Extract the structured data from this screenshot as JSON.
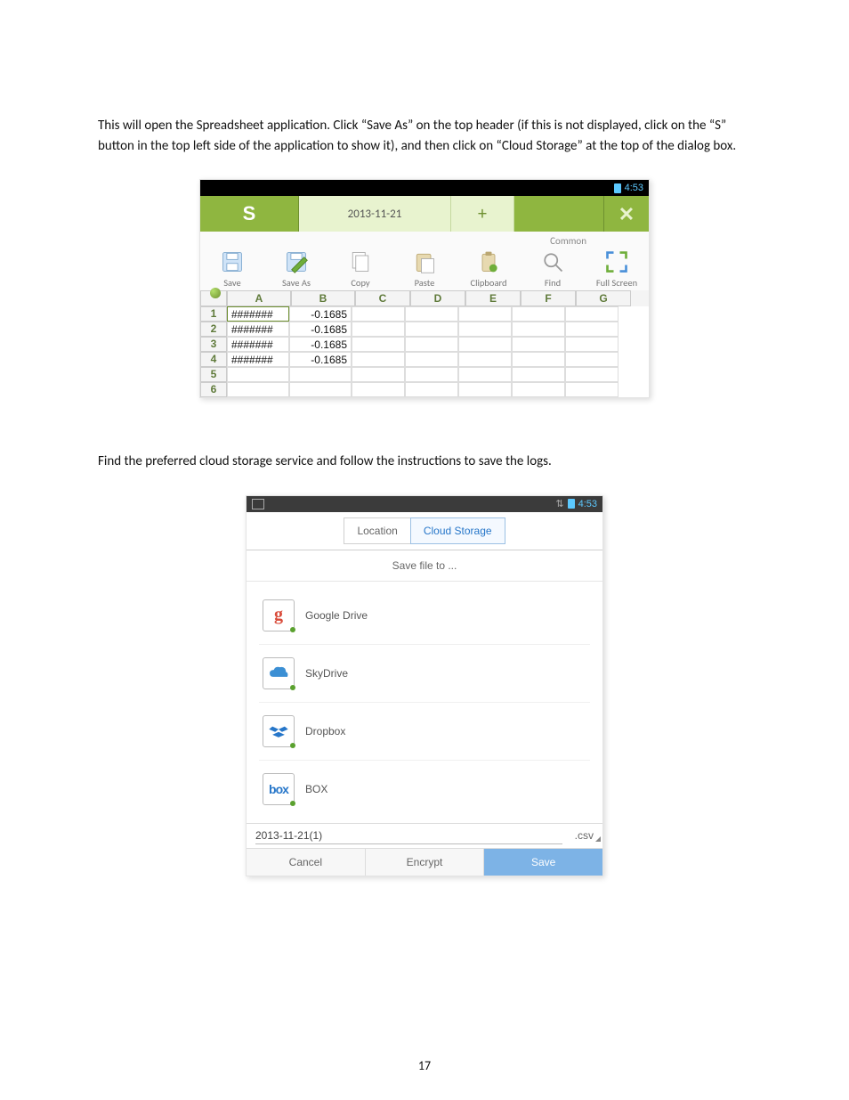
{
  "text": {
    "para1": "This will open the Spreadsheet application. Click “Save As” on the top header (if this is not displayed, click on the “S” button in the top left side of the application to show it), and then click on “Cloud Storage” at the top of the dialog box.",
    "para2": "Find the preferred cloud storage service and follow the instructions to save the logs."
  },
  "page_number": "17",
  "shot1": {
    "status_time": "4:53",
    "app_logo": "S",
    "tab_title": "2013-11-21",
    "add_tab": "+",
    "close": "✕",
    "ribbon_label": "Common",
    "tools": [
      {
        "label": "Save",
        "icon": "save"
      },
      {
        "label": "Save As",
        "icon": "saveas"
      },
      {
        "label": "Copy",
        "icon": "copy"
      },
      {
        "label": "Paste",
        "icon": "paste"
      },
      {
        "label": "Clipboard",
        "icon": "clipboard"
      },
      {
        "label": "Find",
        "icon": "find"
      },
      {
        "label": "Full Screen",
        "icon": "fullscreen"
      }
    ],
    "columns": [
      "A",
      "B",
      "C",
      "D",
      "E",
      "F",
      "G"
    ],
    "rows": [
      {
        "n": "1",
        "A": "#######",
        "B": "-0.1685",
        "C": "",
        "D": "",
        "E": "",
        "F": "",
        "G": ""
      },
      {
        "n": "2",
        "A": "#######",
        "B": "-0.1685",
        "C": "",
        "D": "",
        "E": "",
        "F": "",
        "G": ""
      },
      {
        "n": "3",
        "A": "#######",
        "B": "-0.1685",
        "C": "",
        "D": "",
        "E": "",
        "F": "",
        "G": ""
      },
      {
        "n": "4",
        "A": "#######",
        "B": "-0.1685",
        "C": "",
        "D": "",
        "E": "",
        "F": "",
        "G": ""
      },
      {
        "n": "5",
        "A": "",
        "B": "",
        "C": "",
        "D": "",
        "E": "",
        "F": "",
        "G": ""
      },
      {
        "n": "6",
        "A": "",
        "B": "",
        "C": "",
        "D": "",
        "E": "",
        "F": "",
        "G": ""
      }
    ]
  },
  "shot2": {
    "status_time": "4:53",
    "tab_location": "Location",
    "tab_cloud": "Cloud Storage",
    "save_to": "Save file to ...",
    "services": [
      {
        "label": "Google Drive",
        "icon": "g"
      },
      {
        "label": "SkyDrive",
        "icon": "sky"
      },
      {
        "label": "Dropbox",
        "icon": "dbx"
      },
      {
        "label": "BOX",
        "icon": "box"
      }
    ],
    "filename": "2013-11-21(1)",
    "ext": ".csv",
    "btn_cancel": "Cancel",
    "btn_encrypt": "Encrypt",
    "btn_save": "Save"
  }
}
